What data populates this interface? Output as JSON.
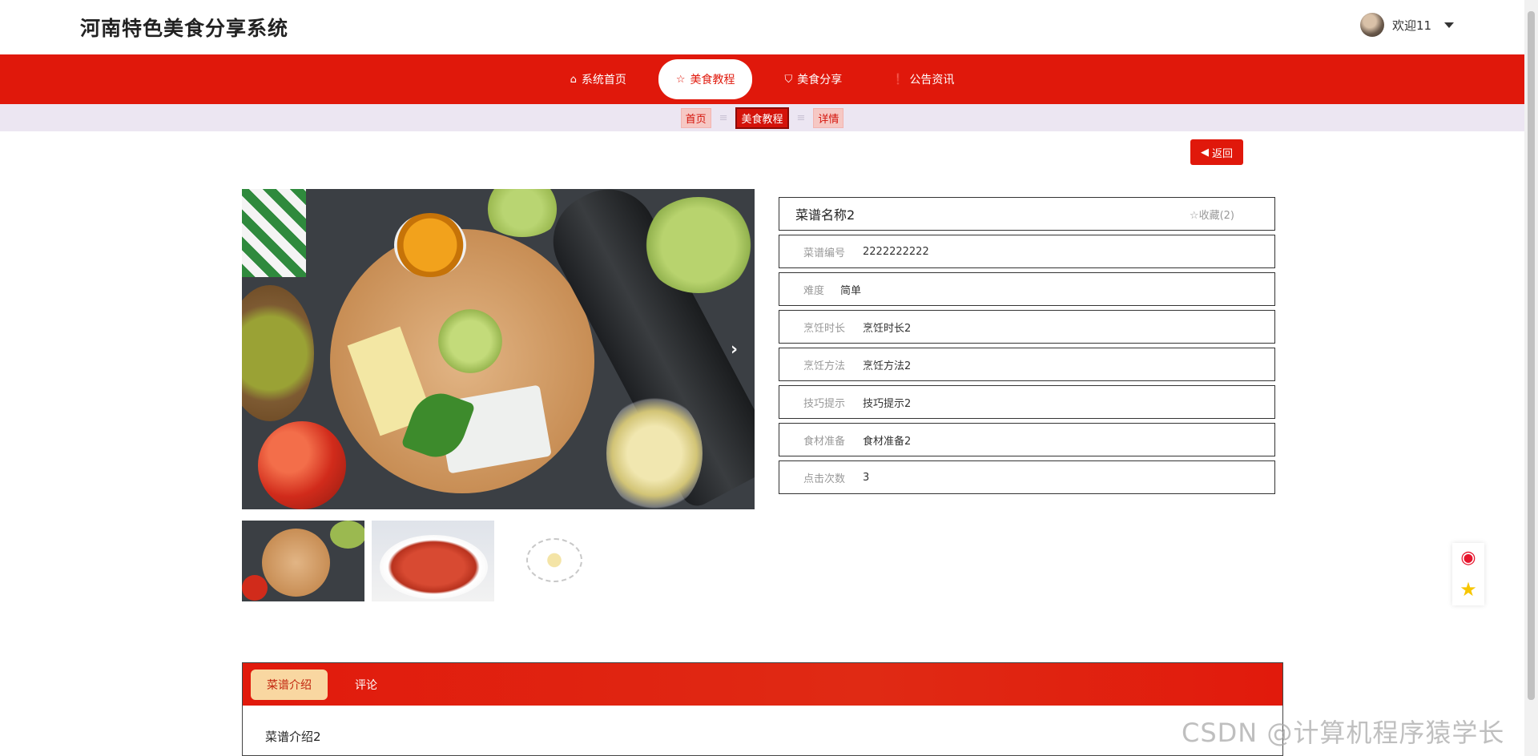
{
  "header": {
    "site_title": "河南特色美食分享系统",
    "welcome": "欢迎11"
  },
  "nav": {
    "items": [
      {
        "label": "系统首页",
        "icon": "home-icon"
      },
      {
        "label": "美食教程",
        "icon": "star-outline-icon"
      },
      {
        "label": "美食分享",
        "icon": "bag-icon"
      },
      {
        "label": "公告资讯",
        "icon": "alert-circle-icon"
      }
    ],
    "active": "美食教程"
  },
  "breadcrumb": {
    "items": [
      "首页",
      "美食教程",
      "详情"
    ],
    "separator": "≡"
  },
  "back_button": "返回",
  "detail": {
    "title": "菜谱名称2",
    "favorite_label": "收藏(2)",
    "fields": [
      {
        "label": "菜谱编号",
        "value": "2222222222"
      },
      {
        "label": "难度",
        "value": "简单"
      },
      {
        "label": "烹饪时长",
        "value": "烹饪时长2"
      },
      {
        "label": "烹饪方法",
        "value": "烹饪方法2"
      },
      {
        "label": "技巧提示",
        "value": "技巧提示2"
      },
      {
        "label": "食材准备",
        "value": "食材准备2"
      },
      {
        "label": "点击次数",
        "value": "3"
      }
    ]
  },
  "tabs": {
    "items": [
      "菜谱介绍",
      "评论"
    ],
    "content": "菜谱介绍2"
  },
  "watermark": "CSDN @计算机程序猿学长",
  "colors": {
    "primary_red": "#e0180b",
    "tab_active_bg": "#f9d7a1",
    "crumb_strip": "#ece6f2"
  }
}
